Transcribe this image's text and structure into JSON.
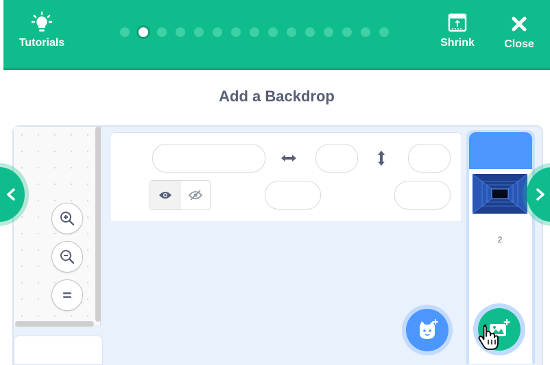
{
  "header": {
    "tutorials_label": "Tutorials",
    "shrink_label": "Shrink",
    "close_label": "Close",
    "step_count": 15,
    "current_step": 2
  },
  "tutorial": {
    "title": "Add a Backdrop"
  },
  "target_pane": {
    "backdrop_count": "2"
  },
  "icons": {
    "tutorials": "lightbulb-icon",
    "shrink": "shrink-icon",
    "close": "close-icon",
    "zoom_in": "zoom-in-icon",
    "zoom_out": "zoom-out-icon",
    "zoom_reset": "zoom-reset-icon",
    "show": "eye-icon",
    "hide": "eye-slash-icon",
    "width": "horizontal-arrow-icon",
    "height": "vertical-arrow-icon",
    "choose_sprite": "cat-plus-icon",
    "choose_backdrop": "image-plus-icon",
    "cursor": "hand-pointer-icon"
  },
  "colors": {
    "header": "#0fbd8c",
    "title_text": "#575e75",
    "stage_selected": "#4c97ff"
  }
}
